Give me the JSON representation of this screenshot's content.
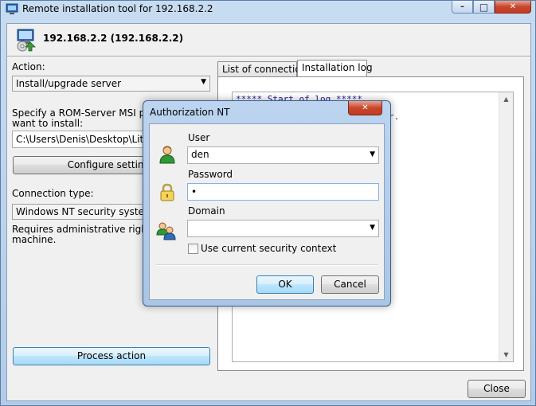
{
  "window": {
    "title": "Remote installation tool for 192.168.2.2",
    "minimize_glyph": "–",
    "maximize_glyph": "□",
    "close_glyph": "✕"
  },
  "header": {
    "title": "192.168.2.2 (192.168.2.2)"
  },
  "left": {
    "action_label": "Action:",
    "action_value": "Install/upgrade server",
    "msi_label_line1": "Specify a ROM-Server MSI package",
    "msi_label_line2": "want to install:",
    "msi_path": "C:\\Users\\Denis\\Desktop\\LiteManager",
    "configure_button": "Configure settings",
    "connection_label": "Connection type:",
    "connection_value": "Windows NT security system",
    "note_line1": "Requires administrative rights on the",
    "note_line2": "machine.",
    "process_button": "Process action"
  },
  "tabs": [
    {
      "label": "List of connections",
      "active": false
    },
    {
      "label": "Installation log",
      "active": true
    }
  ],
  "log": {
    "line1": "***** Start of log *****",
    "line2": "",
    "line3": "                          rver."
  },
  "close_button": "Close",
  "dialog": {
    "title": "Authorization NT",
    "close_glyph": "✕",
    "user_label": "User",
    "user_value": "den",
    "password_label": "Password",
    "password_value": "•",
    "domain_label": "Domain",
    "domain_value": "",
    "checkbox_label": "Use current security context",
    "checkbox_checked": false,
    "ok_button": "OK",
    "cancel_button": "Cancel"
  },
  "icons": {
    "dropdown": "▼",
    "scroll_up": "▲",
    "scroll_down": "▼"
  }
}
